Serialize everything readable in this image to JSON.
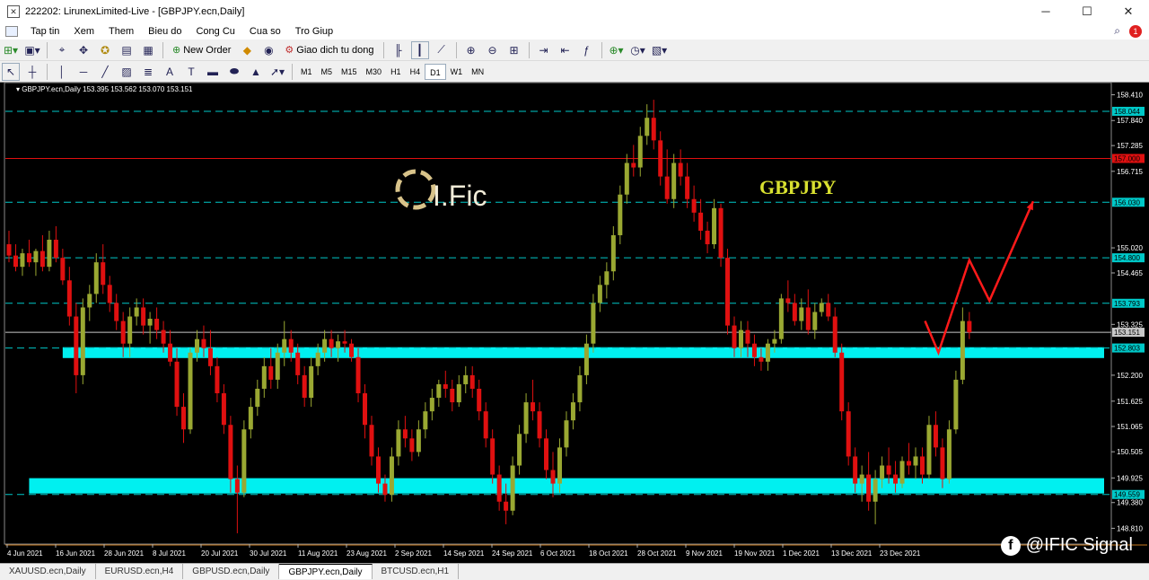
{
  "window": {
    "title": "222202: LirunexLimited-Live - [GBPJPY.ecn,Daily]",
    "app_icon": "mt4-logo-icon"
  },
  "menu": {
    "items": [
      "Tap tin",
      "Xem",
      "Them",
      "Bieu do",
      "Cong Cu",
      "Cua so",
      "Tro Giup"
    ],
    "notification_count": "1"
  },
  "toolbar": {
    "new_order_label": "New Order",
    "auto_trading_label": "Giao dich tu dong"
  },
  "timeframes": [
    "M1",
    "M5",
    "M15",
    "M30",
    "H1",
    "H4",
    "D1",
    "W1",
    "MN"
  ],
  "active_timeframe": "D1",
  "chart": {
    "header": "GBPJPY.ecn,Daily  153.395 153.562 153.070 153.151",
    "symbol_label": "GBPJPY",
    "logo_text": "I.Fic",
    "watermark": "@IFIC Signal",
    "colors": {
      "candle_up": "#9aa832",
      "candle_down": "#e01010",
      "zone": "#00f0f0",
      "resistance": "#e01010",
      "level": "#00c8c8",
      "symbol": "#d8e030",
      "arrow": "#ff1a1a"
    }
  },
  "chart_data": {
    "type": "candlestick",
    "symbol": "GBPJPY.ecn",
    "timeframe": "Daily",
    "ylim": [
      148.5,
      158.6
    ],
    "price_ticks": [
      "158.410",
      "157.840",
      "157.285",
      "156.715",
      "155.020",
      "154.465",
      "153.325",
      "152.200",
      "151.625",
      "151.065",
      "150.505",
      "149.925",
      "149.380",
      "148.810"
    ],
    "date_ticks": [
      "4 Jun 2021",
      "16 Jun 2021",
      "28 Jun 2021",
      "8 Jul 2021",
      "20 Jul 2021",
      "30 Jul 2021",
      "11 Aug 2021",
      "23 Aug 2021",
      "2 Sep 2021",
      "14 Sep 2021",
      "24 Sep 2021",
      "6 Oct 2021",
      "18 Oct 2021",
      "28 Oct 2021",
      "9 Nov 2021",
      "19 Nov 2021",
      "1 Dec 2021",
      "13 Dec 2021",
      "23 Dec 2021"
    ],
    "horizontal_levels": [
      {
        "price": 158.044,
        "label": "158.044",
        "style": "dashed",
        "color": "#00c8c8"
      },
      {
        "price": 157.0,
        "label": "157.000",
        "style": "solid",
        "color": "#e01010"
      },
      {
        "price": 156.03,
        "label": "156.030",
        "style": "dashed",
        "color": "#00c8c8"
      },
      {
        "price": 154.8,
        "label": "154.800",
        "style": "dashed",
        "color": "#00c8c8"
      },
      {
        "price": 153.793,
        "label": "153.793",
        "style": "dashed",
        "color": "#00c8c8"
      },
      {
        "price": 153.151,
        "label": "153.151",
        "style": "solid",
        "color": "#c8c8c8"
      },
      {
        "price": 152.803,
        "label": "152.803",
        "style": "dashed",
        "color": "#00c8c8"
      },
      {
        "price": 149.559,
        "label": "149.559",
        "style": "dashed",
        "color": "#00c8c8"
      }
    ],
    "zones": [
      {
        "from": 152.58,
        "to": 152.82
      },
      {
        "from": 149.58,
        "to": 149.92
      }
    ],
    "candles": [
      {
        "o": 155.1,
        "h": 155.4,
        "l": 154.7,
        "c": 154.85
      },
      {
        "o": 154.85,
        "h": 155.1,
        "l": 154.5,
        "c": 154.6
      },
      {
        "o": 154.6,
        "h": 155.0,
        "l": 154.4,
        "c": 154.9
      },
      {
        "o": 154.9,
        "h": 155.2,
        "l": 154.6,
        "c": 154.7
      },
      {
        "o": 154.7,
        "h": 155.0,
        "l": 154.4,
        "c": 154.95
      },
      {
        "o": 154.95,
        "h": 155.3,
        "l": 154.5,
        "c": 154.6
      },
      {
        "o": 154.6,
        "h": 155.4,
        "l": 154.5,
        "c": 155.2
      },
      {
        "o": 155.2,
        "h": 155.5,
        "l": 154.7,
        "c": 154.8
      },
      {
        "o": 154.8,
        "h": 155.0,
        "l": 154.2,
        "c": 154.3
      },
      {
        "o": 154.3,
        "h": 154.6,
        "l": 153.3,
        "c": 153.5
      },
      {
        "o": 153.5,
        "h": 153.8,
        "l": 151.8,
        "c": 152.2
      },
      {
        "o": 152.2,
        "h": 153.9,
        "l": 152.0,
        "c": 153.7
      },
      {
        "o": 153.7,
        "h": 154.2,
        "l": 153.4,
        "c": 154.0
      },
      {
        "o": 154.0,
        "h": 154.9,
        "l": 153.8,
        "c": 154.7
      },
      {
        "o": 154.7,
        "h": 155.1,
        "l": 154.0,
        "c": 154.2
      },
      {
        "o": 154.2,
        "h": 154.4,
        "l": 153.6,
        "c": 153.8
      },
      {
        "o": 153.8,
        "h": 154.0,
        "l": 153.2,
        "c": 153.4
      },
      {
        "o": 153.4,
        "h": 153.6,
        "l": 152.6,
        "c": 152.9
      },
      {
        "o": 152.9,
        "h": 153.7,
        "l": 152.6,
        "c": 153.5
      },
      {
        "o": 153.5,
        "h": 153.9,
        "l": 153.3,
        "c": 153.7
      },
      {
        "o": 153.7,
        "h": 153.9,
        "l": 153.1,
        "c": 153.3
      },
      {
        "o": 153.3,
        "h": 153.6,
        "l": 152.9,
        "c": 153.45
      },
      {
        "o": 153.45,
        "h": 153.7,
        "l": 153.0,
        "c": 153.2
      },
      {
        "o": 153.2,
        "h": 153.4,
        "l": 152.7,
        "c": 152.9
      },
      {
        "o": 152.9,
        "h": 153.2,
        "l": 152.4,
        "c": 152.5
      },
      {
        "o": 152.5,
        "h": 152.8,
        "l": 151.3,
        "c": 151.5
      },
      {
        "o": 151.5,
        "h": 151.8,
        "l": 150.7,
        "c": 151.0
      },
      {
        "o": 151.0,
        "h": 152.8,
        "l": 150.9,
        "c": 152.7
      },
      {
        "o": 152.7,
        "h": 153.2,
        "l": 152.5,
        "c": 153.0
      },
      {
        "o": 153.0,
        "h": 153.3,
        "l": 152.6,
        "c": 152.8
      },
      {
        "o": 152.8,
        "h": 153.2,
        "l": 152.2,
        "c": 152.4
      },
      {
        "o": 152.4,
        "h": 152.6,
        "l": 151.6,
        "c": 151.8
      },
      {
        "o": 151.8,
        "h": 152.0,
        "l": 150.9,
        "c": 151.1
      },
      {
        "o": 151.1,
        "h": 151.3,
        "l": 149.6,
        "c": 149.9
      },
      {
        "o": 149.9,
        "h": 150.2,
        "l": 148.7,
        "c": 149.6
      },
      {
        "o": 149.6,
        "h": 151.2,
        "l": 149.5,
        "c": 151.0
      },
      {
        "o": 151.0,
        "h": 151.7,
        "l": 150.8,
        "c": 151.5
      },
      {
        "o": 151.5,
        "h": 152.1,
        "l": 151.3,
        "c": 151.9
      },
      {
        "o": 151.9,
        "h": 152.6,
        "l": 151.7,
        "c": 152.4
      },
      {
        "o": 152.4,
        "h": 152.8,
        "l": 151.9,
        "c": 152.1
      },
      {
        "o": 152.1,
        "h": 152.9,
        "l": 151.9,
        "c": 152.7
      },
      {
        "o": 152.7,
        "h": 153.4,
        "l": 152.4,
        "c": 153.0
      },
      {
        "o": 153.0,
        "h": 153.2,
        "l": 152.5,
        "c": 152.7
      },
      {
        "o": 152.7,
        "h": 152.9,
        "l": 152.0,
        "c": 152.2
      },
      {
        "o": 152.2,
        "h": 152.4,
        "l": 151.5,
        "c": 151.7
      },
      {
        "o": 151.7,
        "h": 152.6,
        "l": 151.5,
        "c": 152.4
      },
      {
        "o": 152.4,
        "h": 152.9,
        "l": 152.2,
        "c": 152.7
      },
      {
        "o": 152.7,
        "h": 153.2,
        "l": 152.5,
        "c": 153.0
      },
      {
        "o": 153.0,
        "h": 153.2,
        "l": 152.6,
        "c": 152.8
      },
      {
        "o": 152.8,
        "h": 153.1,
        "l": 152.5,
        "c": 152.95
      },
      {
        "o": 152.95,
        "h": 153.2,
        "l": 152.7,
        "c": 152.9
      },
      {
        "o": 152.9,
        "h": 153.0,
        "l": 152.5,
        "c": 152.6
      },
      {
        "o": 152.6,
        "h": 152.8,
        "l": 151.6,
        "c": 151.8
      },
      {
        "o": 151.8,
        "h": 152.0,
        "l": 150.8,
        "c": 151.1
      },
      {
        "o": 151.1,
        "h": 151.3,
        "l": 150.2,
        "c": 150.4
      },
      {
        "o": 150.4,
        "h": 150.6,
        "l": 149.6,
        "c": 149.8
      },
      {
        "o": 149.8,
        "h": 150.0,
        "l": 149.4,
        "c": 149.55
      },
      {
        "o": 149.55,
        "h": 150.6,
        "l": 149.4,
        "c": 150.4
      },
      {
        "o": 150.4,
        "h": 151.2,
        "l": 150.2,
        "c": 151.0
      },
      {
        "o": 151.0,
        "h": 151.3,
        "l": 150.6,
        "c": 150.8
      },
      {
        "o": 150.8,
        "h": 151.0,
        "l": 150.3,
        "c": 150.5
      },
      {
        "o": 150.5,
        "h": 151.2,
        "l": 150.4,
        "c": 151.0
      },
      {
        "o": 151.0,
        "h": 151.6,
        "l": 150.8,
        "c": 151.4
      },
      {
        "o": 151.4,
        "h": 151.9,
        "l": 151.2,
        "c": 151.7
      },
      {
        "o": 151.7,
        "h": 152.1,
        "l": 151.5,
        "c": 152.0
      },
      {
        "o": 152.0,
        "h": 152.3,
        "l": 151.7,
        "c": 151.9
      },
      {
        "o": 151.9,
        "h": 152.1,
        "l": 151.4,
        "c": 151.6
      },
      {
        "o": 151.6,
        "h": 152.2,
        "l": 151.5,
        "c": 152.0
      },
      {
        "o": 152.0,
        "h": 152.4,
        "l": 151.8,
        "c": 152.2
      },
      {
        "o": 152.2,
        "h": 152.4,
        "l": 151.7,
        "c": 151.9
      },
      {
        "o": 151.9,
        "h": 152.1,
        "l": 151.2,
        "c": 151.4
      },
      {
        "o": 151.4,
        "h": 151.6,
        "l": 150.6,
        "c": 150.8
      },
      {
        "o": 150.8,
        "h": 151.0,
        "l": 149.8,
        "c": 150.0
      },
      {
        "o": 150.0,
        "h": 150.2,
        "l": 149.2,
        "c": 149.4
      },
      {
        "o": 149.4,
        "h": 149.8,
        "l": 148.9,
        "c": 149.2
      },
      {
        "o": 149.2,
        "h": 150.4,
        "l": 149.1,
        "c": 150.2
      },
      {
        "o": 150.2,
        "h": 151.1,
        "l": 150.0,
        "c": 150.9
      },
      {
        "o": 150.9,
        "h": 151.8,
        "l": 150.7,
        "c": 151.6
      },
      {
        "o": 151.6,
        "h": 152.1,
        "l": 151.2,
        "c": 151.4
      },
      {
        "o": 151.4,
        "h": 151.6,
        "l": 150.6,
        "c": 150.8
      },
      {
        "o": 150.8,
        "h": 151.0,
        "l": 149.9,
        "c": 150.1
      },
      {
        "o": 150.1,
        "h": 150.5,
        "l": 149.5,
        "c": 149.8
      },
      {
        "o": 149.8,
        "h": 150.8,
        "l": 149.6,
        "c": 150.6
      },
      {
        "o": 150.6,
        "h": 151.4,
        "l": 150.4,
        "c": 151.2
      },
      {
        "o": 151.2,
        "h": 151.8,
        "l": 151.0,
        "c": 151.6
      },
      {
        "o": 151.6,
        "h": 152.4,
        "l": 151.4,
        "c": 152.2
      },
      {
        "o": 152.2,
        "h": 153.1,
        "l": 152.0,
        "c": 152.9
      },
      {
        "o": 152.9,
        "h": 154.0,
        "l": 152.7,
        "c": 153.8
      },
      {
        "o": 153.8,
        "h": 154.4,
        "l": 153.6,
        "c": 154.2
      },
      {
        "o": 154.2,
        "h": 154.7,
        "l": 153.9,
        "c": 154.5
      },
      {
        "o": 154.5,
        "h": 155.5,
        "l": 154.3,
        "c": 155.3
      },
      {
        "o": 155.3,
        "h": 156.4,
        "l": 155.1,
        "c": 156.2
      },
      {
        "o": 156.2,
        "h": 157.1,
        "l": 156.0,
        "c": 156.9
      },
      {
        "o": 156.9,
        "h": 157.3,
        "l": 156.6,
        "c": 156.8
      },
      {
        "o": 156.8,
        "h": 157.7,
        "l": 156.6,
        "c": 157.5
      },
      {
        "o": 157.5,
        "h": 158.2,
        "l": 157.3,
        "c": 157.9
      },
      {
        "o": 157.9,
        "h": 158.3,
        "l": 157.2,
        "c": 157.4
      },
      {
        "o": 157.4,
        "h": 157.6,
        "l": 156.4,
        "c": 156.6
      },
      {
        "o": 156.6,
        "h": 157.2,
        "l": 156.0,
        "c": 156.1
      },
      {
        "o": 156.1,
        "h": 157.1,
        "l": 155.9,
        "c": 156.9
      },
      {
        "o": 156.9,
        "h": 157.2,
        "l": 156.4,
        "c": 156.6
      },
      {
        "o": 156.6,
        "h": 156.9,
        "l": 155.9,
        "c": 156.1
      },
      {
        "o": 156.1,
        "h": 156.4,
        "l": 155.6,
        "c": 155.8
      },
      {
        "o": 155.8,
        "h": 156.1,
        "l": 155.2,
        "c": 155.4
      },
      {
        "o": 155.4,
        "h": 155.6,
        "l": 154.9,
        "c": 155.1
      },
      {
        "o": 155.1,
        "h": 156.1,
        "l": 155.0,
        "c": 155.9
      },
      {
        "o": 155.9,
        "h": 156.0,
        "l": 154.6,
        "c": 154.8
      },
      {
        "o": 154.8,
        "h": 155.0,
        "l": 153.1,
        "c": 153.3
      },
      {
        "o": 153.3,
        "h": 153.5,
        "l": 152.6,
        "c": 152.8
      },
      {
        "o": 152.8,
        "h": 153.4,
        "l": 152.6,
        "c": 153.2
      },
      {
        "o": 153.2,
        "h": 153.4,
        "l": 152.6,
        "c": 152.9
      },
      {
        "o": 152.9,
        "h": 153.1,
        "l": 152.4,
        "c": 152.6
      },
      {
        "o": 152.6,
        "h": 152.8,
        "l": 152.3,
        "c": 152.5
      },
      {
        "o": 152.5,
        "h": 153.0,
        "l": 152.3,
        "c": 152.9
      },
      {
        "o": 152.9,
        "h": 153.2,
        "l": 152.7,
        "c": 153.0
      },
      {
        "o": 153.0,
        "h": 154.0,
        "l": 152.9,
        "c": 153.9
      },
      {
        "o": 153.9,
        "h": 154.3,
        "l": 153.6,
        "c": 153.8
      },
      {
        "o": 153.8,
        "h": 154.0,
        "l": 153.3,
        "c": 153.4
      },
      {
        "o": 153.4,
        "h": 153.9,
        "l": 153.2,
        "c": 153.7
      },
      {
        "o": 153.7,
        "h": 154.1,
        "l": 153.1,
        "c": 153.2
      },
      {
        "o": 153.2,
        "h": 153.8,
        "l": 153.0,
        "c": 153.6
      },
      {
        "o": 153.6,
        "h": 153.9,
        "l": 153.5,
        "c": 153.8
      },
      {
        "o": 153.8,
        "h": 154.0,
        "l": 153.4,
        "c": 153.5
      },
      {
        "o": 153.5,
        "h": 153.7,
        "l": 152.6,
        "c": 152.7
      },
      {
        "o": 152.7,
        "h": 152.9,
        "l": 151.2,
        "c": 151.4
      },
      {
        "o": 151.4,
        "h": 151.6,
        "l": 150.2,
        "c": 150.4
      },
      {
        "o": 150.4,
        "h": 150.6,
        "l": 149.6,
        "c": 149.8
      },
      {
        "o": 149.8,
        "h": 150.2,
        "l": 149.4,
        "c": 150.0
      },
      {
        "o": 150.0,
        "h": 150.5,
        "l": 149.2,
        "c": 149.4
      },
      {
        "o": 149.4,
        "h": 150.1,
        "l": 148.9,
        "c": 149.9
      },
      {
        "o": 149.9,
        "h": 150.4,
        "l": 149.7,
        "c": 150.2
      },
      {
        "o": 150.2,
        "h": 150.6,
        "l": 149.8,
        "c": 150.0
      },
      {
        "o": 150.0,
        "h": 150.3,
        "l": 149.6,
        "c": 149.8
      },
      {
        "o": 149.8,
        "h": 150.4,
        "l": 149.7,
        "c": 150.3
      },
      {
        "o": 150.3,
        "h": 150.7,
        "l": 150.0,
        "c": 150.2
      },
      {
        "o": 150.2,
        "h": 150.6,
        "l": 149.9,
        "c": 150.4
      },
      {
        "o": 150.4,
        "h": 150.6,
        "l": 149.8,
        "c": 150.0
      },
      {
        "o": 150.0,
        "h": 151.3,
        "l": 149.9,
        "c": 151.1
      },
      {
        "o": 151.1,
        "h": 151.4,
        "l": 150.4,
        "c": 150.6
      },
      {
        "o": 150.6,
        "h": 150.8,
        "l": 149.7,
        "c": 149.9
      },
      {
        "o": 149.9,
        "h": 151.2,
        "l": 149.8,
        "c": 151.0
      },
      {
        "o": 151.0,
        "h": 152.3,
        "l": 150.9,
        "c": 152.1
      },
      {
        "o": 152.1,
        "h": 153.7,
        "l": 152.0,
        "c": 153.4
      },
      {
        "o": 153.4,
        "h": 153.6,
        "l": 153.0,
        "c": 153.15
      }
    ],
    "projection_path": [
      {
        "i": 138.4,
        "p": 152.7
      },
      {
        "i": 143.0,
        "p": 154.75
      },
      {
        "i": 146.0,
        "p": 153.85
      },
      {
        "i": 152.5,
        "p": 156.05
      }
    ],
    "projection_start": {
      "i": 136.4,
      "p": 153.4
    }
  },
  "tabs": {
    "items": [
      "XAUUSD.ecn,Daily",
      "EURUSD.ecn,H4",
      "GBPUSD.ecn,Daily",
      "GBPJPY.ecn,Daily",
      "BTCUSD.ecn,H1"
    ],
    "active": "GBPJPY.ecn,Daily"
  }
}
